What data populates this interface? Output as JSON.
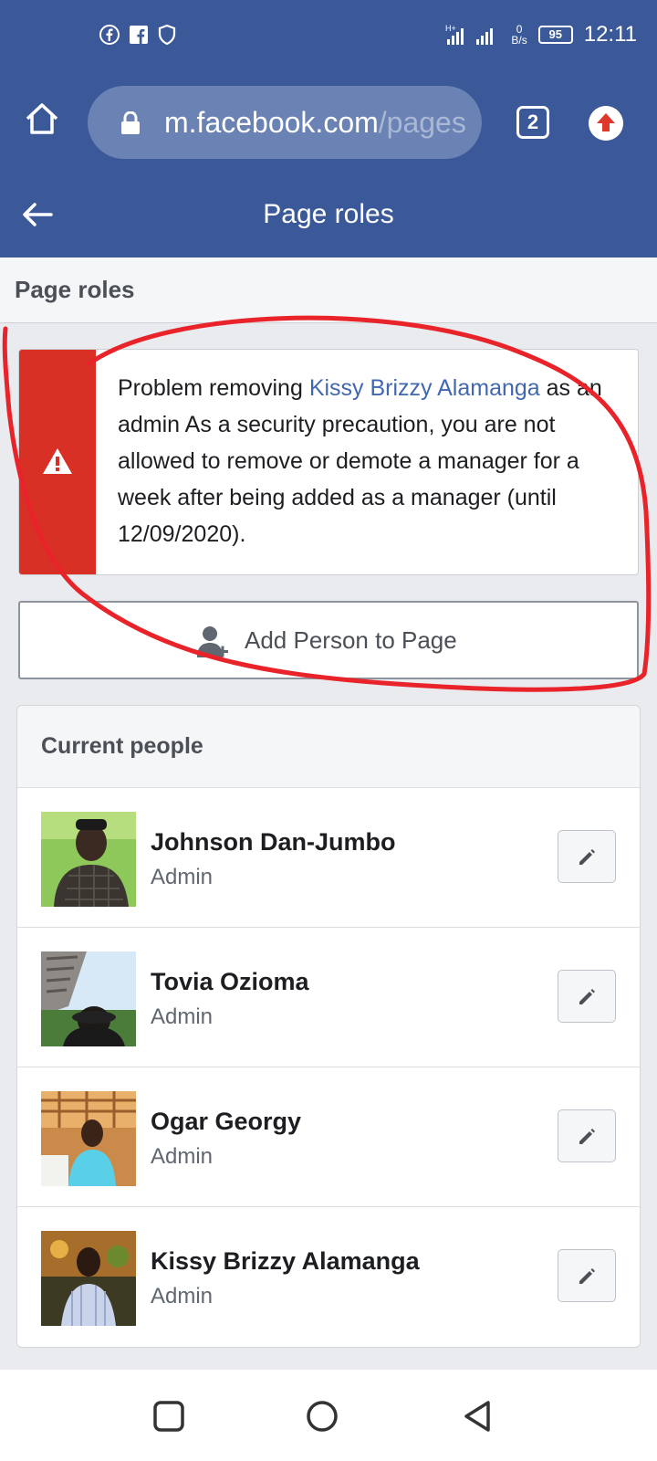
{
  "status_bar": {
    "time": "12:11",
    "battery": "95",
    "net_speed_value": "0",
    "net_speed_unit": "B/s",
    "icons": [
      "facebook-icon",
      "facebook-square-icon",
      "shield-icon",
      "signal-icon",
      "battery-icon"
    ]
  },
  "browser": {
    "url_main": "m.facebook.com",
    "url_rest": "/pages",
    "tab_count": "2"
  },
  "header": {
    "title": "Page roles"
  },
  "section": {
    "title": "Page roles"
  },
  "error": {
    "prefix": "Problem removing ",
    "link_name": "Kissy Brizzy Alamanga",
    "message": " as an admin As a security precaution, you are not allowed to remove or demote a manager for a week after being added as a manager (until 12/09/2020)."
  },
  "add_person": {
    "label": "Add Person to Page"
  },
  "people": {
    "title": "Current people",
    "items": [
      {
        "name": "Johnson Dan-Jumbo",
        "role": "Admin"
      },
      {
        "name": "Tovia Ozioma",
        "role": "Admin"
      },
      {
        "name": "Ogar Georgy",
        "role": "Admin"
      },
      {
        "name": "Kissy Brizzy Alamanga",
        "role": "Admin"
      }
    ]
  },
  "colors": {
    "brand": "#3b5998",
    "error": "#d93025",
    "link": "#4267b2",
    "annotation": "#e8232a"
  }
}
